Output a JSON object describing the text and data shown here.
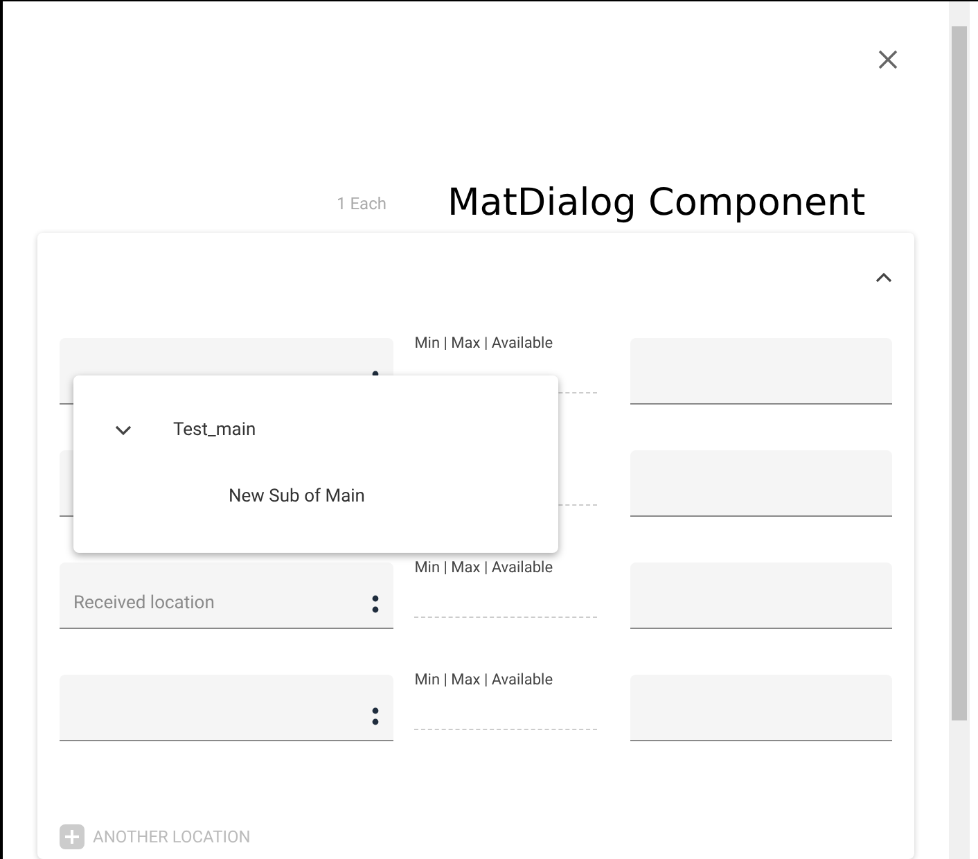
{
  "dialog": {
    "label": "MatDialog Component",
    "summary": [
      {
        "value": "1 Each"
      }
    ]
  },
  "card": {
    "expanded": true,
    "rows": [
      {
        "location": {
          "covered": false
        },
        "stock": {
          "label": "Min | Max | Available"
        }
      },
      {
        "location": {
          "covered": true
        },
        "stock": {}
      },
      {
        "location": {
          "covered": false,
          "label": "Received location"
        },
        "stock": {
          "label": "Min | Max | Available"
        }
      },
      {
        "location": {
          "covered": false
        },
        "stock": {
          "label": "Min | Max | Available"
        }
      }
    ],
    "add_button": "ANOTHER LOCATION"
  },
  "dropdown": {
    "items": [
      {
        "label": "Test_main",
        "expanded": true,
        "children": [
          {
            "label": "New Sub of Main"
          }
        ]
      }
    ]
  }
}
